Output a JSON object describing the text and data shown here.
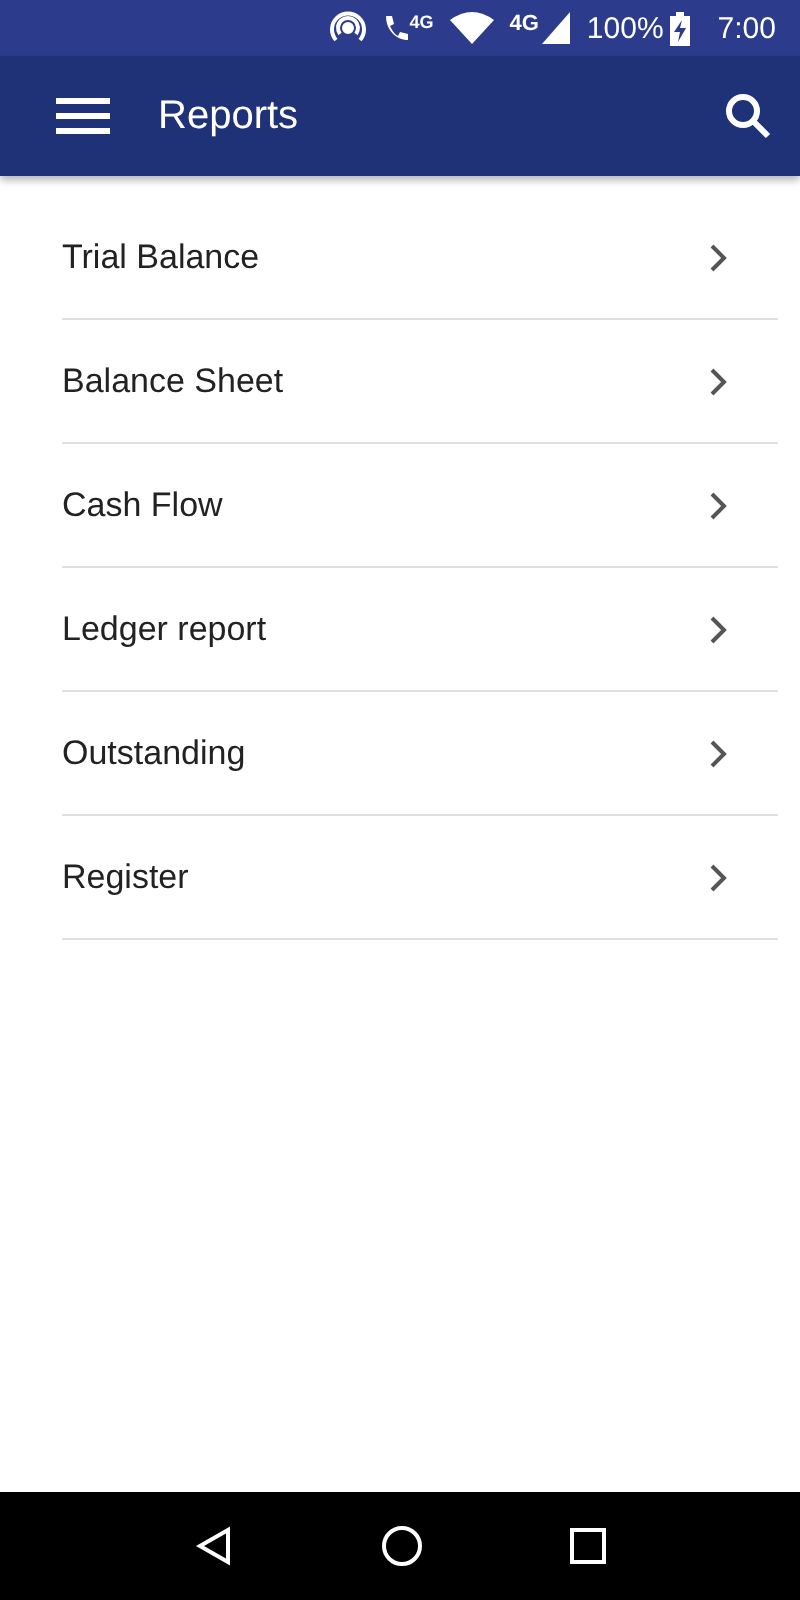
{
  "status_bar": {
    "call_badge": "4G",
    "network": "4G",
    "battery": "100%",
    "time": "7:00"
  },
  "app_bar": {
    "title": "Reports"
  },
  "items": [
    {
      "label": "Trial Balance"
    },
    {
      "label": "Balance Sheet"
    },
    {
      "label": "Cash Flow"
    },
    {
      "label": "Ledger report"
    },
    {
      "label": "Outstanding"
    },
    {
      "label": "Register"
    }
  ]
}
